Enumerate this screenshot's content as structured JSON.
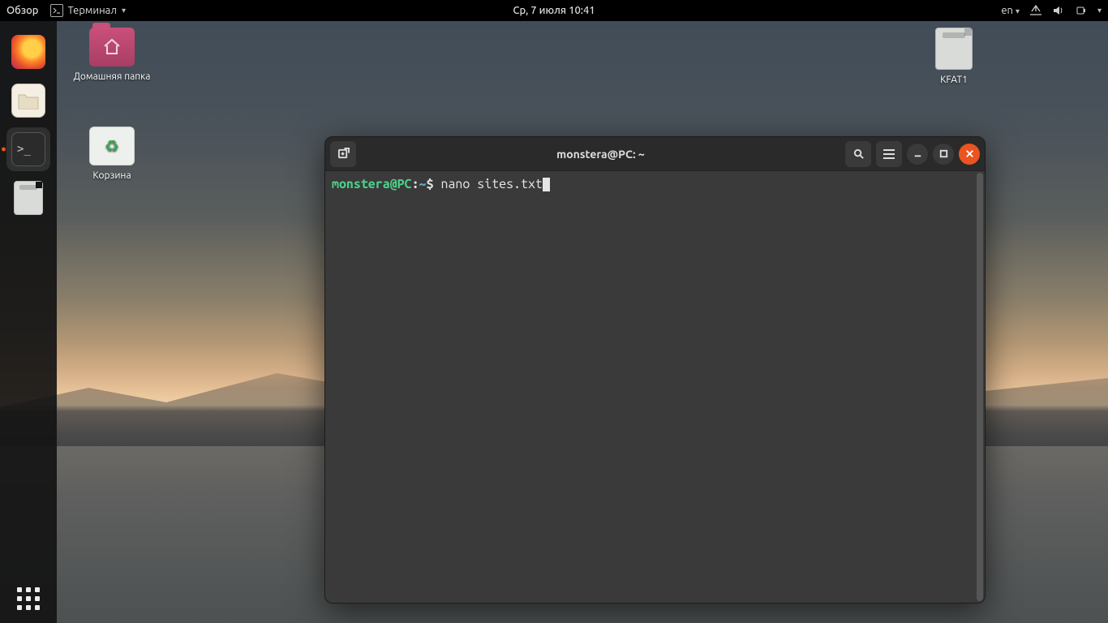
{
  "topbar": {
    "activities": "Обзор",
    "app_menu": "Терминал",
    "datetime": "Ср, 7 июля  10:41",
    "lang": "en"
  },
  "dock": {
    "items": [
      {
        "name": "firefox",
        "label": "Firefox"
      },
      {
        "name": "files",
        "label": "Files"
      },
      {
        "name": "terminal",
        "label": "Terminal",
        "active": true
      },
      {
        "name": "sdcard",
        "label": "Removable"
      }
    ],
    "apps_label": "Show Applications"
  },
  "desktop": {
    "home_label": "Домашняя папка",
    "trash_label": "Корзина",
    "sd_label": "KFAT1"
  },
  "terminal": {
    "title": "monstera@PC: ~",
    "prompt_user": "monstera",
    "prompt_host": "PC",
    "prompt_path": "~",
    "prompt_symbol": "$",
    "command": "nano sites.txt"
  }
}
